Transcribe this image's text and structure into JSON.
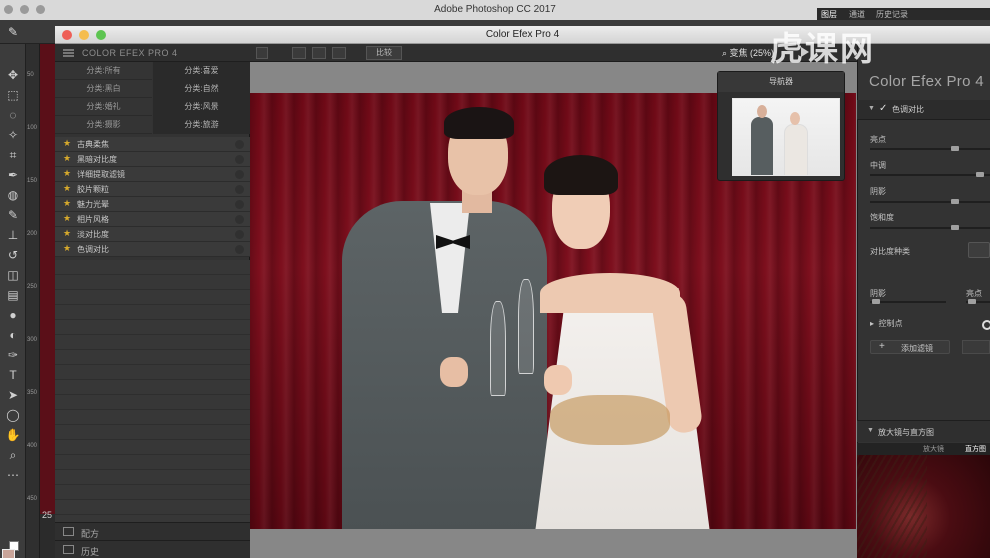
{
  "app": {
    "title": "Adobe Photoshop CC 2017"
  },
  "ps_panel_tabs": [
    "图层",
    "通道",
    "历史记录"
  ],
  "watermark": "虎课网",
  "ps": {
    "zoom": "25"
  },
  "window": {
    "title": "Color Efex Pro 4"
  },
  "left_panel": {
    "brand": "COLOR EFEX PRO 4",
    "categories": [
      "分类:所有",
      "分类:喜爱",
      "分类:黑白",
      "分类:自然",
      "分类:婚礼",
      "分类:风景",
      "分类:摄影",
      "分类:旅游"
    ],
    "filters": [
      "古典柔焦",
      "黑暗对比度",
      "详细提取滤镜",
      "胶片颗粒",
      "魅力光晕",
      "相片风格",
      "淡对比度",
      "色调对比"
    ],
    "footer": {
      "recipes": "配方",
      "history": "历史"
    }
  },
  "toolbar": {
    "compare": "比较",
    "zoom_label": "变焦 (25%)"
  },
  "navigator": {
    "title": "导航器"
  },
  "right_panel": {
    "brand": "Color Efex Pro 4",
    "section": "色调对比",
    "params": {
      "highlights": "亮点",
      "midtones": "中调",
      "shadows": "阴影",
      "saturation": "饱和度",
      "contrast_type": "对比度种类"
    },
    "slider_values": {
      "highlights": 0.72,
      "midtones": 0.95,
      "shadows": 0.72,
      "saturation": 0.72
    },
    "protect_shadows": "阴影",
    "protect_highlights": "亮点",
    "control_points": "控制点",
    "add_filter": "添加滤镜",
    "loupe": {
      "title": "放大镜与直方图",
      "tabs": [
        "放大镜",
        "直方图"
      ]
    }
  }
}
